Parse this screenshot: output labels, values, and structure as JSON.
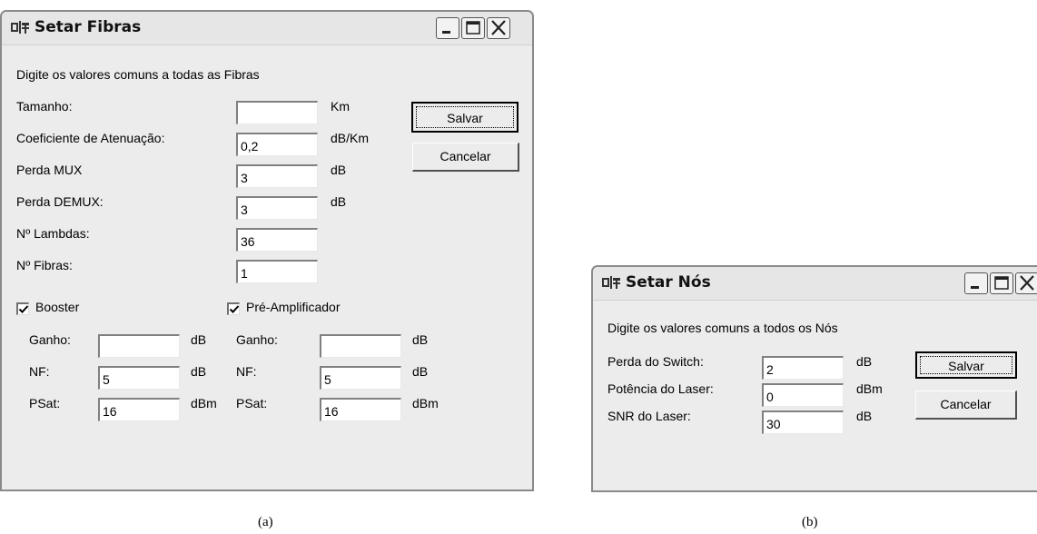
{
  "fibras": {
    "title": "Setar Fibras",
    "prompt": "Digite os valores comuns a todas as Fibras",
    "fields": [
      {
        "label": "Tamanho:",
        "value": "",
        "unit": "Km"
      },
      {
        "label": "Coeficiente de Atenuação:",
        "value": "0,2",
        "unit": "dB/Km"
      },
      {
        "label": "Perda MUX",
        "value": "3",
        "unit": "dB"
      },
      {
        "label": "Perda DEMUX:",
        "value": "3",
        "unit": "dB"
      },
      {
        "label": "Nº Lambdas:",
        "value": "36",
        "unit": ""
      },
      {
        "label": "Nº Fibras:",
        "value": "1",
        "unit": ""
      }
    ],
    "save_label": "Salvar",
    "cancel_label": "Cancelar",
    "booster": {
      "label": "Booster",
      "checked": true,
      "rows": [
        {
          "label": "Ganho:",
          "value": "",
          "unit": "dB"
        },
        {
          "label": "NF:",
          "value": "5",
          "unit": "dB"
        },
        {
          "label": "PSat:",
          "value": "16",
          "unit": "dBm"
        }
      ]
    },
    "pre_amp": {
      "label": "Pré-Amplificador",
      "checked": true,
      "rows": [
        {
          "label": "Ganho:",
          "value": "",
          "unit": "dB"
        },
        {
          "label": "NF:",
          "value": "5",
          "unit": "dB"
        },
        {
          "label": "PSat:",
          "value": "16",
          "unit": "dBm"
        }
      ]
    }
  },
  "nos": {
    "title": "Setar Nós",
    "prompt": "Digite os valores comuns a todos os Nós",
    "fields": [
      {
        "label": "Perda do Switch:",
        "value": "2",
        "unit": "dB"
      },
      {
        "label": "Potência do Laser:",
        "value": "0",
        "unit": "dBm"
      },
      {
        "label": "SNR do Laser:",
        "value": "30",
        "unit": "dB"
      }
    ],
    "save_label": "Salvar",
    "cancel_label": "Cancelar"
  },
  "captions": {
    "a": "(a)",
    "b": "(b)"
  }
}
